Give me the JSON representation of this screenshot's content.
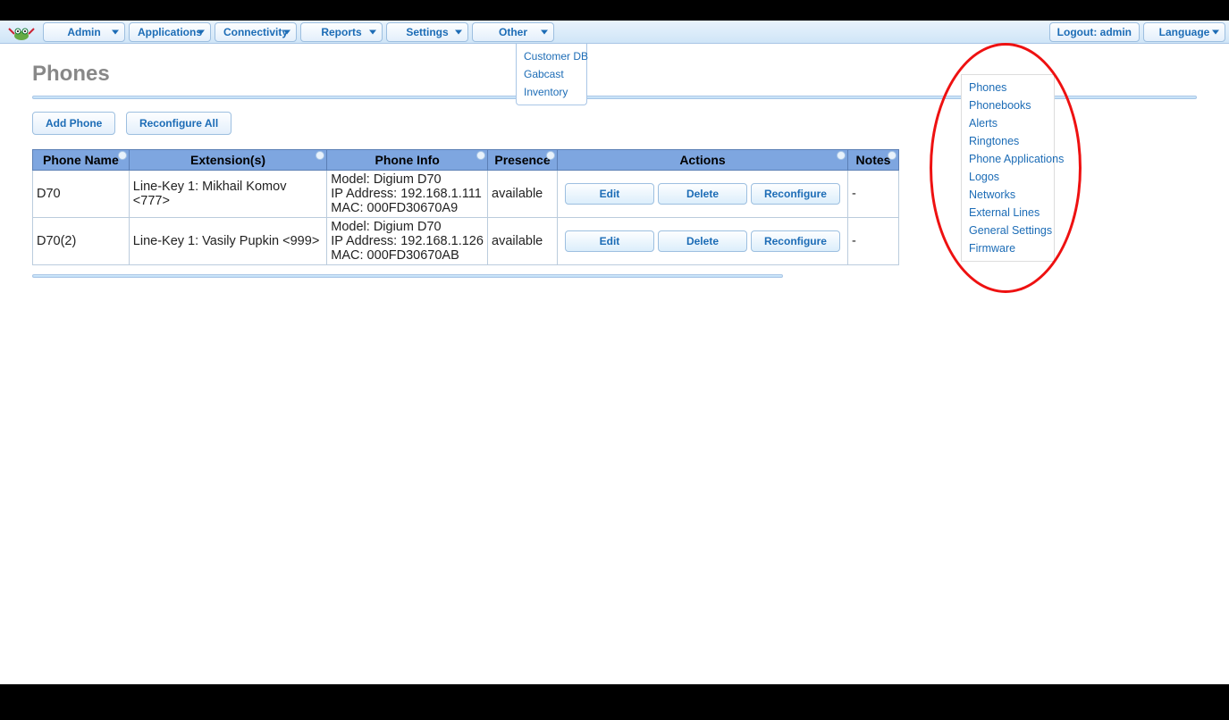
{
  "nav": {
    "items": [
      "Admin",
      "Applications",
      "Connectivity",
      "Reports",
      "Settings",
      "Other"
    ],
    "right": [
      "Logout: admin",
      "Language"
    ]
  },
  "dropdown_other": [
    "Customer DB",
    "Gabcast",
    "Inventory"
  ],
  "page_title": "Phones",
  "toolbar": {
    "add_phone": "Add Phone",
    "reconfigure_all": "Reconfigure All"
  },
  "table": {
    "headers": [
      "Phone Name",
      "Extension(s)",
      "Phone Info",
      "Presence",
      "Actions",
      "Notes"
    ],
    "rows": [
      {
        "name": "D70",
        "ext": "Line-Key 1: Mikhail Komov <777>",
        "info": "Model: Digium D70\nIP Address: 192.168.1.111\nMAC: 000FD30670A9",
        "presence": "available",
        "notes": "-"
      },
      {
        "name": "D70(2)",
        "ext": "Line-Key 1: Vasily Pupkin <999>",
        "info": "Model: Digium D70\nIP Address: 192.168.1.126\nMAC: 000FD30670AB",
        "presence": "available",
        "notes": "-"
      }
    ],
    "row_buttons": [
      "Edit",
      "Delete",
      "Reconfigure"
    ]
  },
  "side_panel": [
    "Phones",
    "Phonebooks",
    "Alerts",
    "Ringtones",
    "Phone Applications",
    "Logos",
    "Networks",
    "External Lines",
    "General Settings",
    "Firmware"
  ]
}
